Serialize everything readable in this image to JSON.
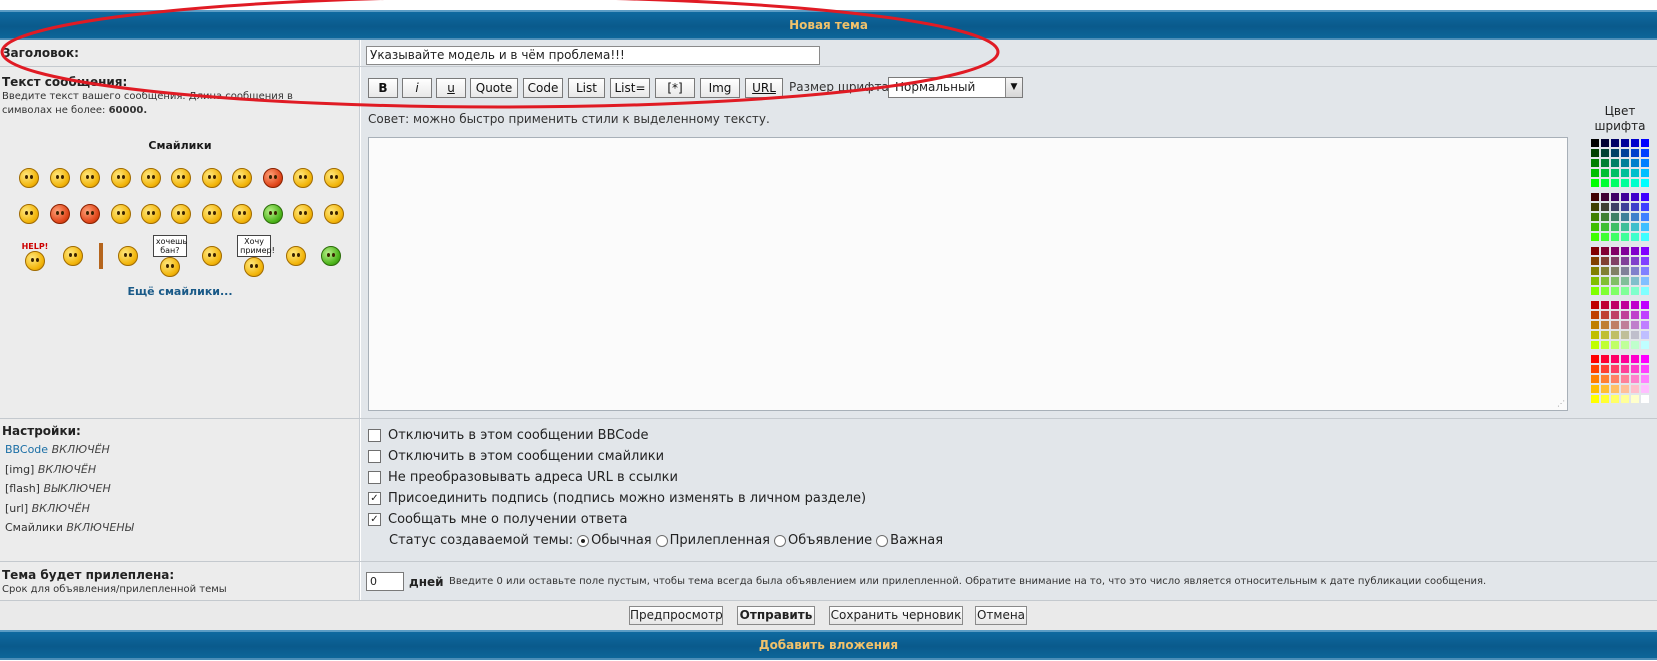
{
  "header": {
    "title": "Новая тема"
  },
  "subject": {
    "label": "Заголовок:",
    "value": "Указывайте модель и в чём проблема!!!"
  },
  "message": {
    "label": "Текст сообщения:",
    "hint_prefix": "Введите текст вашего сообщения. Длина сообщения в символах не более: ",
    "hint_limit": "60000."
  },
  "toolbar": {
    "buttons": [
      "B",
      "i",
      "u",
      "Quote",
      "Code",
      "List",
      "List=",
      "[*]",
      "Img",
      "URL"
    ],
    "font_size_label": "Размер шрифта:",
    "font_size_value": "Нормальный",
    "tip": "Совет: можно быстро применить стили к выделенному тексту."
  },
  "color": {
    "label": "Цвет шрифта"
  },
  "smileys": {
    "title": "Смайлики",
    "more": "Ещё смайлики...",
    "sign1": "хочешь бан?",
    "sign2": "Хочу пример!",
    "help": "HELP!"
  },
  "settings": {
    "label": "Настройки:",
    "items": [
      {
        "name": "BBCode",
        "state": "ВКЛЮЧЁН"
      },
      {
        "name": "[img]",
        "state": "ВКЛЮЧЁН"
      },
      {
        "name": "[flash]",
        "state": "ВЫКЛЮЧЕН"
      },
      {
        "name": "[url]",
        "state": "ВКЛЮЧЁН"
      },
      {
        "name": "Смайлики",
        "state": "ВКЛЮЧЕНЫ"
      }
    ]
  },
  "options": [
    {
      "label": "Отключить в этом сообщении BBCode",
      "checked": false
    },
    {
      "label": "Отключить в этом сообщении смайлики",
      "checked": false
    },
    {
      "label": "Не преобразовывать адреса URL в ссылки",
      "checked": false
    },
    {
      "label": "Присоединить подпись (подпись можно изменять в личном разделе)",
      "checked": true
    },
    {
      "label": "Сообщать мне о получении ответа",
      "checked": true
    }
  ],
  "topic_status": {
    "label": "Статус создаваемой темы:",
    "choices": [
      "Обычная",
      "Прилепленная",
      "Объявление",
      "Важная"
    ],
    "selected": "Обычная"
  },
  "sticky": {
    "label": "Тема будет прилеплена:",
    "sublabel": "Срок для объявления/прилепленной темы",
    "value": "0",
    "unit": "дней",
    "note": "Введите 0 или оставьте поле пустым, чтобы тема всегда была объявлением или прилепленной. Обратите внимание на то, что это число является относительным к дате публикации сообщения."
  },
  "actions": {
    "preview": "Предпросмотр",
    "submit": "Отправить",
    "save_draft": "Сохранить черновик",
    "cancel": "Отмена"
  },
  "footer": {
    "title": "Добавить вложения"
  },
  "accent_colors": {
    "header": "#0a5a8c",
    "header_text": "#f1c26b",
    "annotation": "#e01b24"
  }
}
